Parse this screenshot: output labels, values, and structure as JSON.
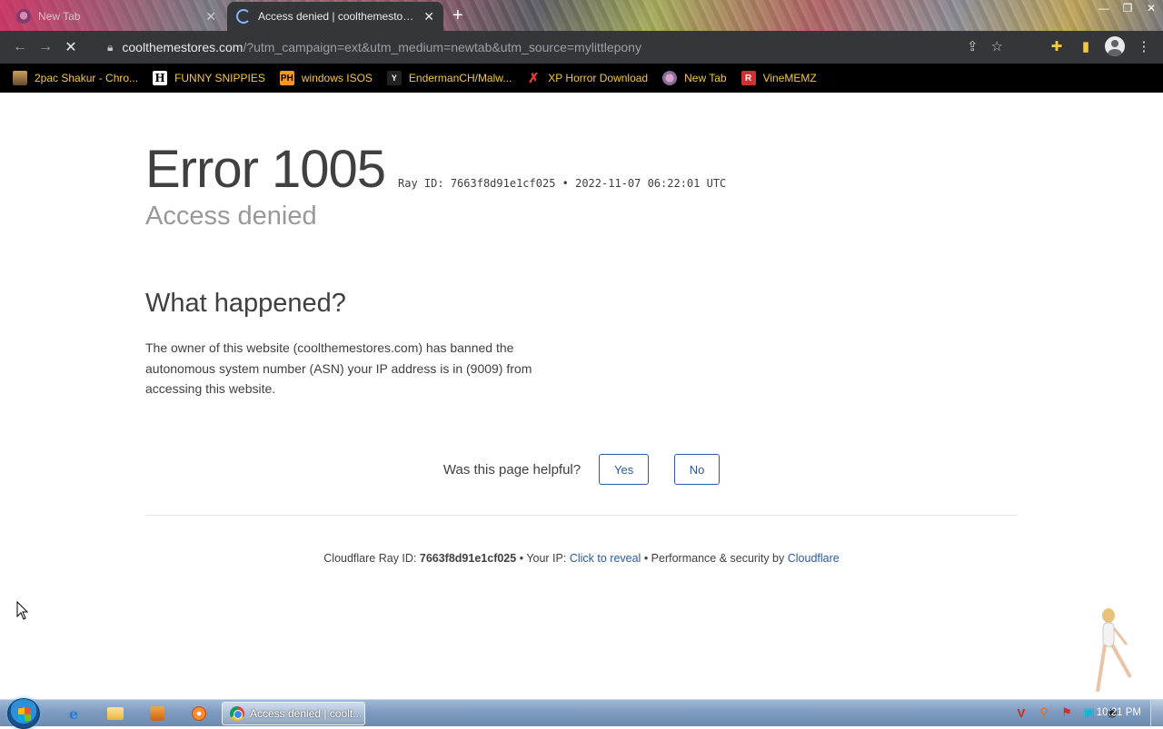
{
  "tabs": [
    {
      "title": "New Tab",
      "active": false
    },
    {
      "title": "Access denied | coolthemestores.com",
      "active": true
    }
  ],
  "window_controls": {
    "minimize": "—",
    "restore": "❐",
    "close": "✕"
  },
  "address_bar": {
    "host": "coolthemestores.com",
    "path": "/?utm_campaign=ext&utm_medium=newtab&utm_source=mylittlepony"
  },
  "bookmarks": [
    {
      "label": "2pac Shakur - Chro...",
      "icon": "pac-icon"
    },
    {
      "label": "FUNNY SNIPPIES",
      "icon": "h-icon"
    },
    {
      "label": "windows ISOS",
      "icon": "ph-icon"
    },
    {
      "label": "EndermanCH/Malw...",
      "icon": "yt-icon"
    },
    {
      "label": "XP Horror Download",
      "icon": "x-icon"
    },
    {
      "label": "New Tab",
      "icon": "newtab-icon"
    },
    {
      "label": "VineMEMZ",
      "icon": "r-icon"
    }
  ],
  "error": {
    "title": "Error 1005",
    "ray_id_label": "Ray ID: 7663f8d91e1cf025",
    "timestamp": "2022-11-07 06:22:01 UTC",
    "subtitle": "Access denied"
  },
  "what_happened": {
    "heading": "What happened?",
    "body": "The owner of this website (coolthemestores.com) has banned the autonomous system number (ASN) your IP address is in (9009) from accessing this website."
  },
  "feedback": {
    "question": "Was this page helpful?",
    "yes": "Yes",
    "no": "No"
  },
  "footer": {
    "ray_label": "Cloudflare Ray ID:",
    "ray_id": "7663f8d91e1cf025",
    "ip_label": "Your IP:",
    "reveal": "Click to reveal",
    "perf_label": "Performance & security by",
    "cloudflare": "Cloudflare"
  },
  "taskbar": {
    "task_label": "Access denied | coolt...",
    "clock": "10:21 PM"
  },
  "colors": {
    "link": "#2c5aa0",
    "bookmark_text": "#f4c842",
    "toolbar": "#35363a"
  }
}
